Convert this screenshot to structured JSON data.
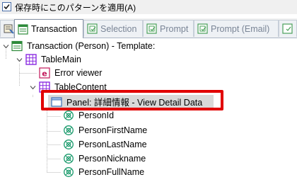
{
  "options": {
    "apply_on_save_label": "保存時にこのパターンを適用(A)",
    "apply_on_save_checked": true
  },
  "tabs": [
    {
      "label": "",
      "icon": "properties-icon",
      "active": false
    },
    {
      "label": "Transaction",
      "icon": "transaction-icon",
      "active": true
    },
    {
      "label": "Selection",
      "icon": "selection-icon",
      "active": false
    },
    {
      "label": "Prompt",
      "icon": "prompt-icon",
      "active": false
    },
    {
      "label": "Prompt (Email)",
      "icon": "prompt-email-icon",
      "active": false
    },
    {
      "label": "",
      "icon": "prompt-more-icon",
      "active": false
    }
  ],
  "tree": {
    "root": "Transaction (Person) - Template:",
    "table_main": "TableMain",
    "error_viewer": "Error viewer",
    "table_content": "TableContent",
    "panel": "Panel: 詳細情報 - View Detail Data",
    "attributes": [
      "PersonId",
      "PersonFirstName",
      "PersonLastName",
      "PersonNickname",
      "PersonFullName"
    ]
  },
  "colors": {
    "highlight": "#e10000",
    "selection": "#d9d9d9",
    "table_icon": "#8a2be2",
    "attribute_icon": "#1a9a6c"
  }
}
